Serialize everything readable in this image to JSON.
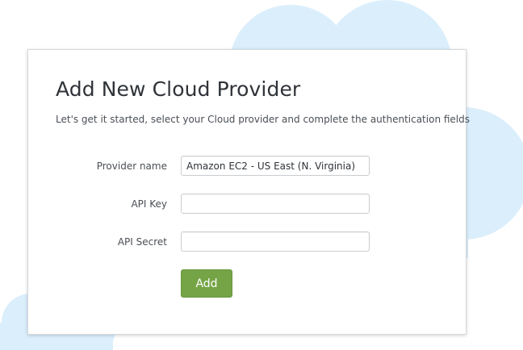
{
  "form": {
    "title": "Add New Cloud Provider",
    "subtitle": "Let's get it started, select your Cloud provider and complete the authentication fields",
    "provider_name": {
      "label": "Provider name",
      "value": "Amazon EC2 - US East (N. Virginia)"
    },
    "api_key": {
      "label": "API Key",
      "value": ""
    },
    "api_secret": {
      "label": "API Secret",
      "value": ""
    },
    "add_label": "Add"
  },
  "colors": {
    "cloud": "#dbeefc",
    "button": "#75a446",
    "panel_border": "#d5d9dc",
    "title_text": "#2f3338"
  },
  "decorations": {
    "background_clouds": [
      "large-cloud-top-right",
      "small-cloud-bottom-left"
    ]
  }
}
